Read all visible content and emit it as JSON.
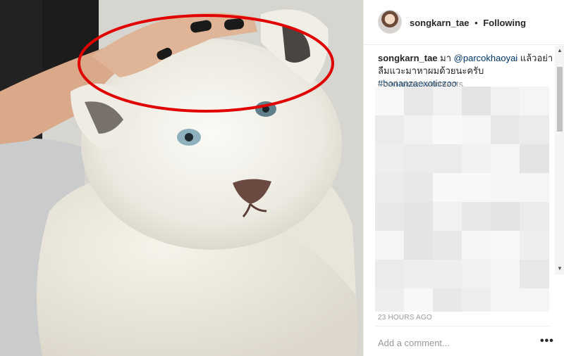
{
  "photo": {
    "alt_icon": "lion-cub-photo"
  },
  "header": {
    "username": "songkarn_tae",
    "separator": "•",
    "follow_label": "Following"
  },
  "caption": {
    "username": "songkarn_tae",
    "text_part1": "มา",
    "mention": "@parcokhaoyai",
    "text_part2": "แล้วอย่าลืมแวะมาหาผมด้วยนะครับ",
    "hashtag": "#bonanzaexoticzoo"
  },
  "load_more_label": "Load more comments",
  "timestamp": "23 HOURS AGO",
  "add_comment_placeholder": "Add a comment...",
  "more_options_label": "•••",
  "colors": {
    "annotation_circle": "#e00000",
    "link": "#003569",
    "muted": "#999999"
  }
}
